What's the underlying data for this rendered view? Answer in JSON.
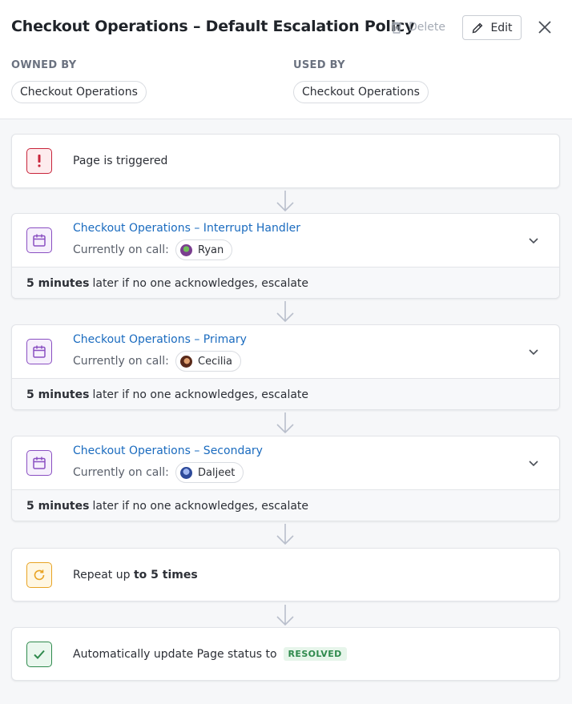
{
  "header": {
    "title": "Checkout Operations – Default Escalation Policy",
    "delete_label": "Delete",
    "edit_label": "Edit",
    "owned_by_label": "OWNED BY",
    "owned_by_value": "Checkout Operations",
    "used_by_label": "USED BY",
    "used_by_value": "Checkout Operations"
  },
  "trigger": {
    "text": "Page is triggered",
    "icon": "alert-icon"
  },
  "oncall_label": "Currently on call:",
  "steps": [
    {
      "rota": "Checkout Operations – Interrupt Handler",
      "user": "Ryan",
      "avatar_color": "#7a3e8f",
      "delay_strong": "5 minutes",
      "delay_rest": "later if no one acknowledges, escalate"
    },
    {
      "rota": "Checkout Operations – Primary",
      "user": "Cecilia",
      "avatar_color": "#8b4a2b",
      "delay_strong": "5 minutes",
      "delay_rest": "later if no one acknowledges, escalate"
    },
    {
      "rota": "Checkout Operations – Secondary",
      "user": "Daljeet",
      "avatar_color": "#2d4a9a",
      "delay_strong": "5 minutes",
      "delay_rest": "later if no one acknowledges, escalate"
    }
  ],
  "repeat": {
    "prefix": "Repeat up",
    "strong": "to 5 times",
    "icon": "repeat-icon"
  },
  "resolve": {
    "text": "Automatically update Page status to",
    "badge": "RESOLVED",
    "icon": "check-icon"
  },
  "colors": {
    "link": "#1a6bbf",
    "trigger_red": "#c8243a",
    "rota_purple": "#8a4fc2",
    "repeat_orange": "#e8a323",
    "resolve_green": "#2f8a4d"
  }
}
